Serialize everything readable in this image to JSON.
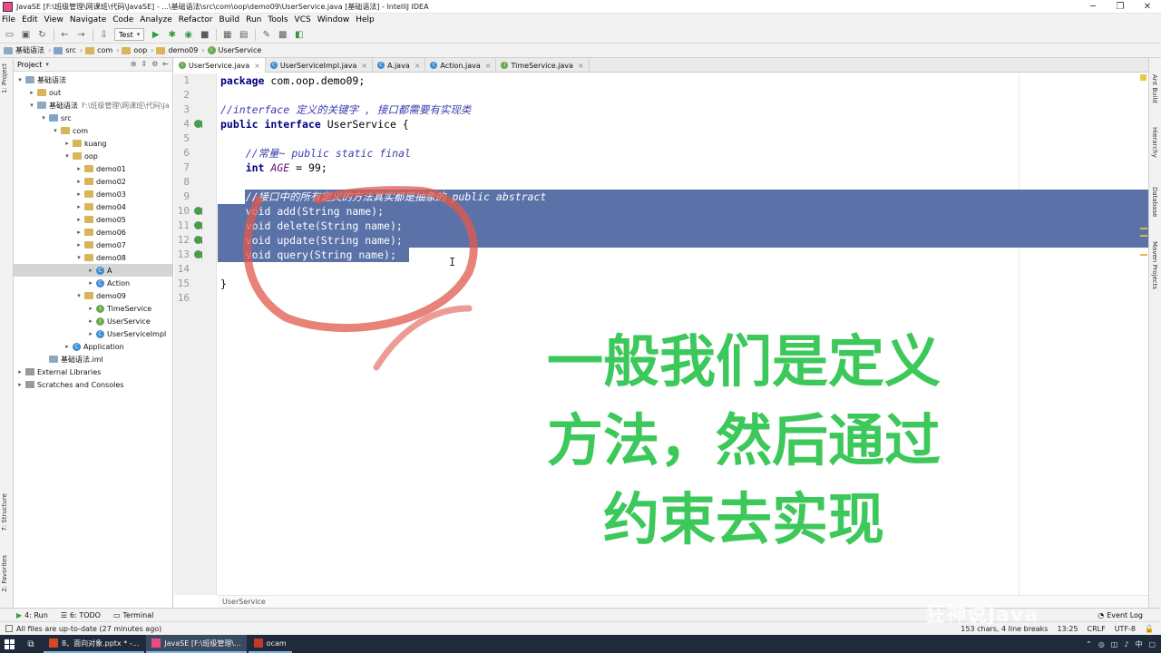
{
  "window": {
    "title": "JavaSE [F:\\班级管理\\网课班\\代码\\JavaSE] - ...\\基础语法\\src\\com\\oop\\demo09\\UserService.java [基础语法] - IntelliJ IDEA",
    "min": "─",
    "max": "❐",
    "close": "✕"
  },
  "menu": [
    "File",
    "Edit",
    "View",
    "Navigate",
    "Code",
    "Analyze",
    "Refactor",
    "Build",
    "Run",
    "Tools",
    "VCS",
    "Window",
    "Help"
  ],
  "toolbar": {
    "run_config": "Test"
  },
  "navbar": {
    "crumbs": [
      {
        "label": "基础语法",
        "kind": "module"
      },
      {
        "label": "src",
        "kind": "folder"
      },
      {
        "label": "com",
        "kind": "folder"
      },
      {
        "label": "oop",
        "kind": "folder"
      },
      {
        "label": "demo09",
        "kind": "folder"
      },
      {
        "label": "UserService",
        "kind": "interface"
      }
    ]
  },
  "left_stripe": {
    "project": "1: Project",
    "structure": "7: Structure",
    "favorites": "2: Favorites"
  },
  "project_panel": {
    "title": "Project",
    "tree": [
      {
        "label": "基础语法",
        "depth": 0,
        "arrow": "▾",
        "icon": "module",
        "sub": ""
      },
      {
        "label": "out",
        "depth": 1,
        "arrow": "▸",
        "icon": "folder",
        "sub": ""
      },
      {
        "label": "基础语法",
        "depth": 1,
        "arrow": "▾",
        "icon": "module",
        "sub": "F:\\班级管理\\网课班\\代码\\Ja"
      },
      {
        "label": "src",
        "depth": 2,
        "arrow": "▾",
        "icon": "blue",
        "sub": ""
      },
      {
        "label": "com",
        "depth": 3,
        "arrow": "▾",
        "icon": "folder",
        "sub": ""
      },
      {
        "label": "kuang",
        "depth": 4,
        "arrow": "▸",
        "icon": "folder",
        "sub": ""
      },
      {
        "label": "oop",
        "depth": 4,
        "arrow": "▾",
        "icon": "folder",
        "sub": ""
      },
      {
        "label": "demo01",
        "depth": 5,
        "arrow": "▸",
        "icon": "folder",
        "sub": ""
      },
      {
        "label": "demo02",
        "depth": 5,
        "arrow": "▸",
        "icon": "folder",
        "sub": ""
      },
      {
        "label": "demo03",
        "depth": 5,
        "arrow": "▸",
        "icon": "folder",
        "sub": ""
      },
      {
        "label": "demo04",
        "depth": 5,
        "arrow": "▸",
        "icon": "folder",
        "sub": ""
      },
      {
        "label": "demo05",
        "depth": 5,
        "arrow": "▸",
        "icon": "folder",
        "sub": ""
      },
      {
        "label": "demo06",
        "depth": 5,
        "arrow": "▸",
        "icon": "folder",
        "sub": ""
      },
      {
        "label": "demo07",
        "depth": 5,
        "arrow": "▸",
        "icon": "folder",
        "sub": ""
      },
      {
        "label": "demo08",
        "depth": 5,
        "arrow": "▾",
        "icon": "folder",
        "sub": ""
      },
      {
        "label": "A",
        "depth": 6,
        "arrow": "▸",
        "icon": "class",
        "sub": "",
        "selected": true
      },
      {
        "label": "Action",
        "depth": 6,
        "arrow": "▸",
        "icon": "class",
        "sub": ""
      },
      {
        "label": "demo09",
        "depth": 5,
        "arrow": "▾",
        "icon": "folder",
        "sub": ""
      },
      {
        "label": "TimeService",
        "depth": 6,
        "arrow": "▸",
        "icon": "interface",
        "sub": ""
      },
      {
        "label": "UserService",
        "depth": 6,
        "arrow": "▸",
        "icon": "interface",
        "sub": ""
      },
      {
        "label": "UserServiceImpl",
        "depth": 6,
        "arrow": "▸",
        "icon": "class",
        "sub": ""
      },
      {
        "label": "Application",
        "depth": 4,
        "arrow": "▸",
        "icon": "class",
        "sub": ""
      },
      {
        "label": "基础语法.iml",
        "depth": 2,
        "arrow": "",
        "icon": "module",
        "sub": ""
      },
      {
        "label": "External Libraries",
        "depth": 0,
        "arrow": "▸",
        "icon": "lib",
        "sub": ""
      },
      {
        "label": "Scratches and Consoles",
        "depth": 0,
        "arrow": "▸",
        "icon": "lib",
        "sub": ""
      }
    ]
  },
  "tabs": [
    {
      "label": "UserService.java",
      "kind": "I",
      "active": true
    },
    {
      "label": "UserServiceImpl.java",
      "kind": "C",
      "active": false
    },
    {
      "label": "A.java",
      "kind": "C",
      "active": false
    },
    {
      "label": "Action.java",
      "kind": "C",
      "active": false
    },
    {
      "label": "TimeService.java",
      "kind": "I",
      "active": false
    }
  ],
  "editor": {
    "lines": [
      {
        "n": "1",
        "html": "<span class=\"kw\">package</span> com.oop.demo09;"
      },
      {
        "n": "2",
        "html": ""
      },
      {
        "n": "3",
        "html": "<span class=\"cmb\">//interface 定义的关键字 , 接口都需要有实现类</span>"
      },
      {
        "n": "4",
        "html": "<span class=\"kw\">public interface</span> UserService {",
        "mark": true
      },
      {
        "n": "5",
        "html": ""
      },
      {
        "n": "6",
        "html": "    <span class=\"cmb\">//常量~ public static final</span>"
      },
      {
        "n": "7",
        "html": "    <span class=\"kw\">int</span> <span class=\"cst\">AGE</span> = 99;"
      },
      {
        "n": "8",
        "html": ""
      },
      {
        "n": "9",
        "html": "    <span class=\"sel-txt\"><i>//接口中的所有定义的方法其实都是抽象的 public abstract</i></span>",
        "sel": true
      },
      {
        "n": "10",
        "html": "    <span class=\"sel-txt\">void add(String name);</span>",
        "mark": true,
        "sel": true
      },
      {
        "n": "11",
        "html": "    <span class=\"sel-txt\">void delete(String name);</span>",
        "mark": true,
        "sel": true
      },
      {
        "n": "12",
        "html": "    <span class=\"sel-txt\">void update(String name);</span>",
        "mark": true,
        "sel": true
      },
      {
        "n": "13",
        "html": "    <span class=\"sel-txt\">void query(String name);</span>",
        "mark": true,
        "sel": true
      },
      {
        "n": "14",
        "html": ""
      },
      {
        "n": "15",
        "html": "}"
      },
      {
        "n": "16",
        "html": ""
      }
    ],
    "footer_crumb": "UserService"
  },
  "annotation": [
    "一般我们是定义",
    "方法，然后通过",
    "约束去实现"
  ],
  "right_stripe": {
    "ant": "Ant Build",
    "hierarchy": "Hierarchy",
    "database": "Database",
    "maven": "Maven Projects"
  },
  "tool_tabs": {
    "run": "4: Run",
    "todo": "6: TODO",
    "terminal": "Terminal",
    "event_log": "Event Log"
  },
  "status": {
    "message": "All files are up-to-date (27 minutes ago)",
    "chars": "153 chars, 4 line breaks",
    "pos": "13:25",
    "line_sep": "CRLF",
    "encoding": "UTF-8"
  },
  "taskbar": {
    "items": [
      {
        "label": "8、面向对象.pptx * -...",
        "color": "#d24726",
        "active": false
      },
      {
        "label": "JavaSE [F:\\班级管理\\...",
        "color": "#e84d8a",
        "active": true
      },
      {
        "label": "ocam",
        "color": "#c0392b",
        "active": false
      }
    ],
    "ime": "中"
  },
  "watermark": "狂神说Java"
}
